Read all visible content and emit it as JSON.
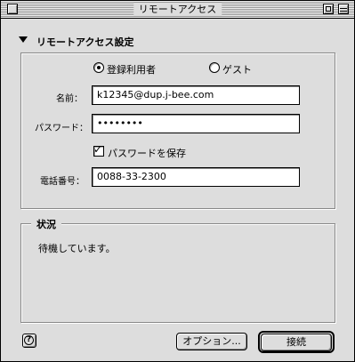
{
  "window": {
    "title": "リモートアクセス"
  },
  "section": {
    "title": "リモートアクセス設定"
  },
  "user_type": {
    "registered_label": "登録利用者",
    "guest_label": "ゲスト",
    "selected": "registered"
  },
  "fields": {
    "name_label": "名前：",
    "name_value": "k12345@dup.j-bee.com",
    "password_label": "パスワード：",
    "password_value": "••••••••",
    "save_password_label": "パスワードを保存",
    "save_password_checked": true,
    "phone_label": "電話番号：",
    "phone_value": "0088-33-2300"
  },
  "status": {
    "title": "状況",
    "text": "待機しています。"
  },
  "buttons": {
    "help": "?",
    "options_label": "オプション...",
    "connect_label": "接続"
  }
}
